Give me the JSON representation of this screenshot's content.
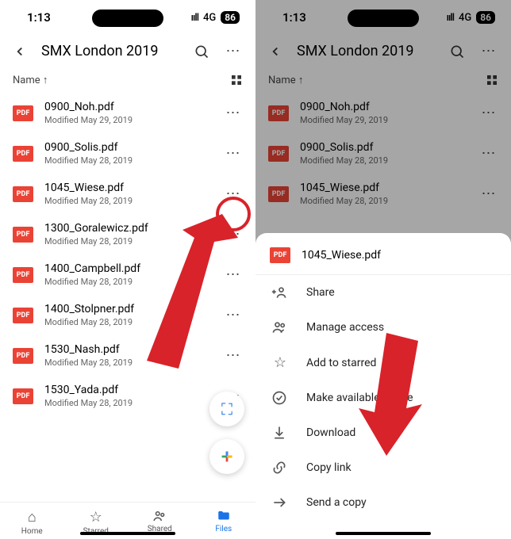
{
  "status": {
    "time": "1:13",
    "network": "4G",
    "battery": "86"
  },
  "header": {
    "title": "SMX London 2019"
  },
  "sort": {
    "label": "Name ↑"
  },
  "files": [
    {
      "name": "0900_Noh.pdf",
      "modified": "Modified May 29, 2019"
    },
    {
      "name": "0900_Solis.pdf",
      "modified": "Modified May 28, 2019"
    },
    {
      "name": "1045_Wiese.pdf",
      "modified": "Modified May 28, 2019"
    },
    {
      "name": "1300_Goralewicz.pdf",
      "modified": "Modified May 28, 2019"
    },
    {
      "name": "1400_Campbell.pdf",
      "modified": "Modified May 28, 2019"
    },
    {
      "name": "1400_Stolpner.pdf",
      "modified": "Modified May 28, 2019"
    },
    {
      "name": "1530_Nash.pdf",
      "modified": "Modified May 28, 2019"
    },
    {
      "name": "1530_Yada.pdf",
      "modified": "Modified May 28, 2019"
    }
  ],
  "nav": {
    "home": "Home",
    "starred": "Starred",
    "shared": "Shared",
    "files": "Files"
  },
  "sheet": {
    "file": "1045_Wiese.pdf",
    "share": "Share",
    "manage": "Manage access",
    "star": "Add to starred",
    "offline": "Make available offline",
    "download": "Download",
    "copylink": "Copy link",
    "sendcopy": "Send a copy"
  },
  "pdf_badge": "PDF"
}
